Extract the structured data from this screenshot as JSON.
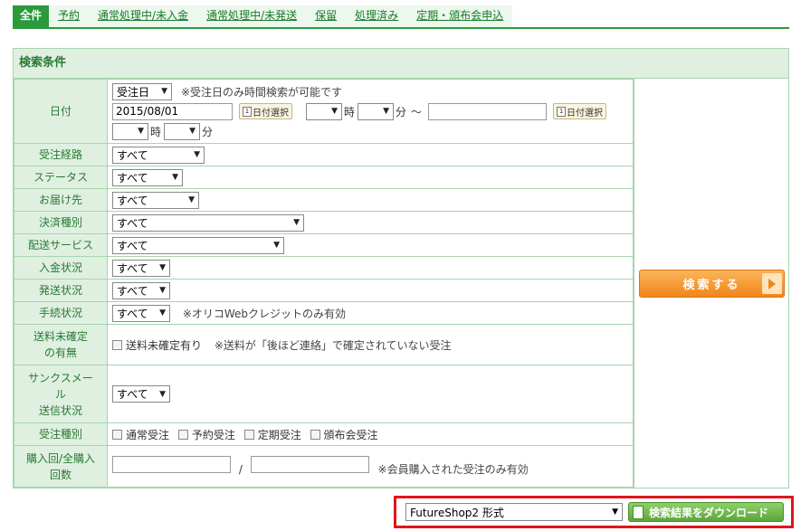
{
  "tabs": [
    {
      "label": "全件",
      "active": true
    },
    {
      "label": "予約"
    },
    {
      "label": "通常処理中/未入金"
    },
    {
      "label": "通常処理中/未発送"
    },
    {
      "label": "保留"
    },
    {
      "label": "処理済み"
    },
    {
      "label": "定期・頒布会申込"
    }
  ],
  "panel": {
    "title": "検索条件"
  },
  "fields": {
    "date": {
      "label": "日付",
      "type_select": "受注日",
      "note": "※受注日のみ時間検索が可能です",
      "start_date": "2015/08/01",
      "end_date": "",
      "calendar_btn": "日付選択",
      "calendar_icon_text": "1",
      "hour_start": "",
      "minute_start": "",
      "hour_end": "",
      "minute_end": "",
      "hour_unit": "時",
      "minute_unit": "分",
      "range_sep": "〜"
    },
    "route": {
      "label": "受注経路",
      "value": "すべて"
    },
    "status": {
      "label": "ステータス",
      "value": "すべて"
    },
    "delivery": {
      "label": "お届け先",
      "value": "すべて"
    },
    "payment_type": {
      "label": "決済種別",
      "value": "すべて"
    },
    "shipping_service": {
      "label": "配送サービス",
      "value": "すべて"
    },
    "payment_status": {
      "label": "入金状況",
      "value": "すべて"
    },
    "shipping_status": {
      "label": "発送状況",
      "value": "すべて"
    },
    "procedure_status": {
      "label": "手続状況",
      "value": "すべて",
      "note": "※オリコWebクレジットのみ有効"
    },
    "shipping_fee": {
      "label_l1": "送料未確定",
      "label_l2": "の有無",
      "checkbox_label": "送料未確定有り",
      "note": "※送料が「後ほど連絡」で確定されていない受注"
    },
    "thanks_mail": {
      "label_l1": "サンクスメー",
      "label_l2": "ル",
      "label_l3": "送信状況",
      "value": "すべて"
    },
    "order_type": {
      "label": "受注種別",
      "options": [
        "通常受注",
        "予約受注",
        "定期受注",
        "頒布会受注"
      ]
    },
    "purchase_count": {
      "label_l1": "購入回/全購入",
      "label_l2": "回数",
      "sep": "/",
      "from": "",
      "to": "",
      "note": "※会員購入された受注のみ有効"
    }
  },
  "search_button": "検索する",
  "download": {
    "format": "FutureShop2 形式",
    "button": "検索結果をダウンロード"
  }
}
